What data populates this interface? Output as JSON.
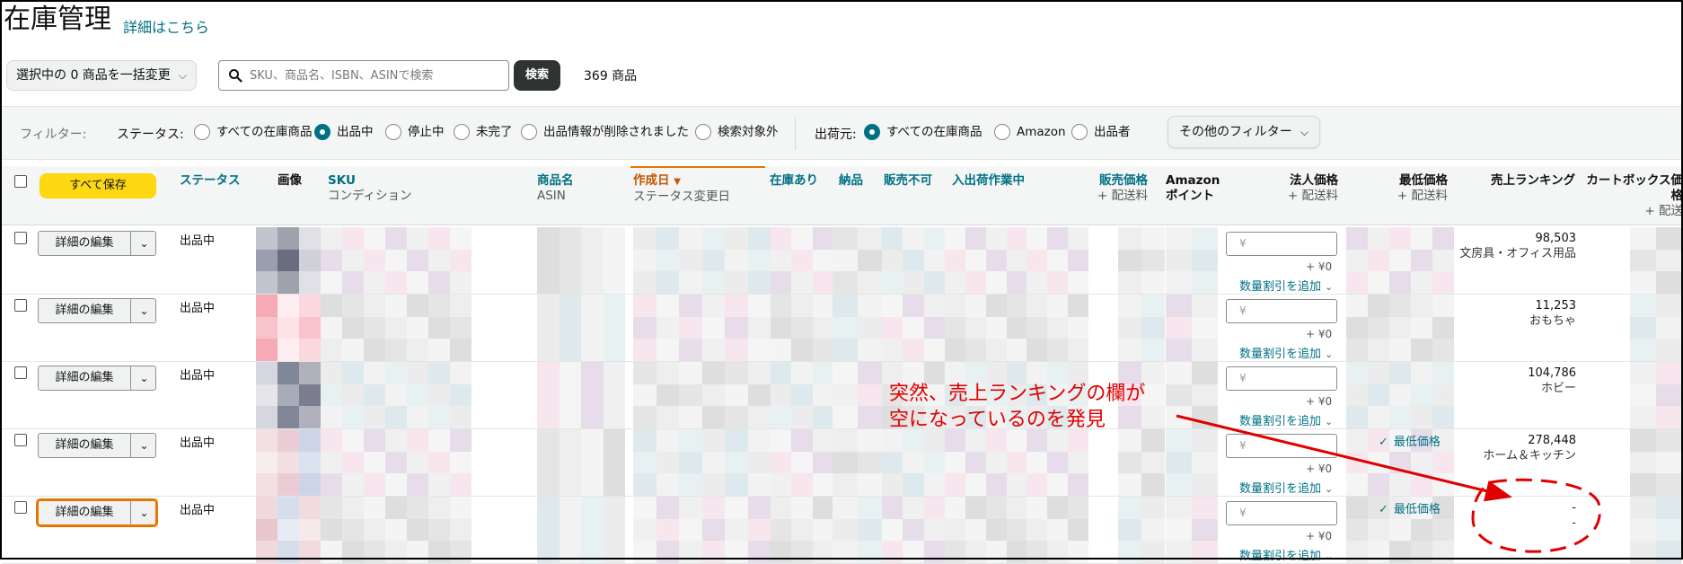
{
  "header": {
    "title": "在庫管理",
    "detail_link": "詳細はこちら"
  },
  "toolbar": {
    "bulk_change": "選択中の 0 商品を一括変更",
    "search_placeholder": "SKU、商品名、ISBN、ASINで検索",
    "search_button": "検索",
    "item_count": "369 商品"
  },
  "filters": {
    "label": "フィルター:",
    "status_label": "ステータス:",
    "status_options": [
      "すべての在庫商品",
      "出品中",
      "停止中",
      "未完了",
      "出品情報が削除されました",
      "検索対象外"
    ],
    "status_selected": "出品中",
    "ship_label": "出荷元:",
    "ship_options": [
      "すべての在庫商品",
      "Amazon",
      "出品者"
    ],
    "ship_selected": "すべての在庫商品",
    "other_filters": "その他のフィルター"
  },
  "table": {
    "save_all": "すべて保存",
    "columns": {
      "status": "ステータス",
      "image": "画像",
      "sku": "SKU",
      "condition": "コンディション",
      "product_name": "商品名",
      "asin": "ASIN",
      "created": "作成日",
      "status_changed": "ステータス変更日",
      "in_stock": "在庫あり",
      "inbound": "納品",
      "unfulfillable": "販売不可",
      "inbound_work": "入出荷作業中",
      "sale_price": "販売価格",
      "sale_price_sub": "+ 配送料",
      "amazon": "Amazon",
      "points": "ポイント",
      "corp_price": "法人価格",
      "corp_price_sub": "+ 配送料",
      "min_price": "最低価格",
      "min_price_sub": "+ 配送料",
      "ranking": "売上ランキング",
      "cartbox_1": "カートボックス価",
      "cartbox_2": "格",
      "cartbox_sub": "+ 配送"
    },
    "rows": [
      {
        "edit": "詳細の編集",
        "status": "出品中",
        "yen": "¥",
        "ship": "+ ¥0",
        "qty_discount": "数量割引を追加",
        "min_price": "",
        "rank": "98,503",
        "category": "文房具・オフィス用品"
      },
      {
        "edit": "詳細の編集",
        "status": "出品中",
        "yen": "¥",
        "ship": "+ ¥0",
        "qty_discount": "数量割引を追加",
        "min_price": "",
        "rank": "11,253",
        "category": "おもちゃ"
      },
      {
        "edit": "詳細の編集",
        "status": "出品中",
        "yen": "¥",
        "ship": "+ ¥0",
        "qty_discount": "数量割引を追加",
        "min_price": "",
        "rank": "104,786",
        "category": "ホビー"
      },
      {
        "edit": "詳細の編集",
        "status": "出品中",
        "yen": "¥",
        "ship": "+ ¥0",
        "qty_discount": "数量割引を追加",
        "min_price": "最低価格",
        "rank": "278,448",
        "category": "ホーム＆キッチン"
      },
      {
        "edit": "詳細の編集",
        "status": "出品中",
        "yen": "¥",
        "ship": "+ ¥0",
        "qty_discount": "数量割引を追加",
        "min_price": "最低価格",
        "rank": "-",
        "category": "-"
      }
    ]
  },
  "annotation": {
    "line1": "突然、売上ランキングの欄が",
    "line2": "空になっているのを発見",
    "color": "#e00000"
  }
}
